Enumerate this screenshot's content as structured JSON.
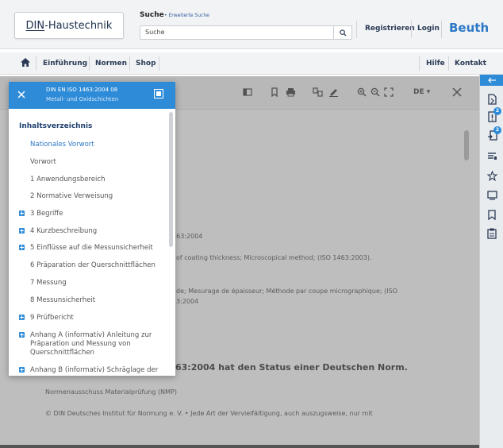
{
  "header": {
    "logo_din": "DIN",
    "logo_rest": "-Haustechnik",
    "search_label": "Suche",
    "search_advanced": "• Erweiterte Suche",
    "search_value": "Suche",
    "register": "Registrieren",
    "login": "Login",
    "brand": "Beuth"
  },
  "nav": {
    "items": [
      "Einführung",
      "Normen",
      "Shop"
    ],
    "help": "Hilfe",
    "contact": "Kontakt"
  },
  "toolbar": {
    "language": "DE ▾"
  },
  "document": {
    "line1": "1463:2004",
    "line2": "of coating thickness; Microscopical method; (ISO 1463:2003).",
    "line3": "de; Mesurage de épaisseur; Méthode par coupe micrographique; (ISO",
    "line4": "3:2004",
    "status": "63:2004 hat den Status einer Deutschen Norm.",
    "committee": "Normenausschuss Materialprüfung (NMP)",
    "copyright": "© DIN Deutsches Institut für Normung e. V. • Jede Art der Vervielfältigung, auch auszugsweise, nur mit"
  },
  "sidebar_badges": {
    "badge1": "2",
    "badge2": "2"
  },
  "toc": {
    "title": "DIN EN ISO 1463:2004 08",
    "subtitle": "Metall- und Oxidschichten",
    "heading": "Inhaltsverzeichnis",
    "items": [
      {
        "label": "Nationales Vorwort"
      },
      {
        "label": "Vorwort"
      },
      {
        "label": "1  Anwendungsbereich"
      },
      {
        "label": "2  Normative Verweisung"
      },
      {
        "label": "3  Begriffe"
      },
      {
        "label": "4  Kurzbeschreibung"
      },
      {
        "label": "5  Einflüsse auf die Messunsicherheit"
      },
      {
        "label": "6  Präparation der Querschnittflächen"
      },
      {
        "label": "7  Messung"
      },
      {
        "label": "8  Messunsicherheit"
      },
      {
        "label": "9  Prüfbericht"
      },
      {
        "label": "Anhang A (informativ)  Anleitung zur Präparation und Messung von Querschnittflächen"
      },
      {
        "label": "Anhang B (informativ)  Schräglage der"
      }
    ]
  }
}
